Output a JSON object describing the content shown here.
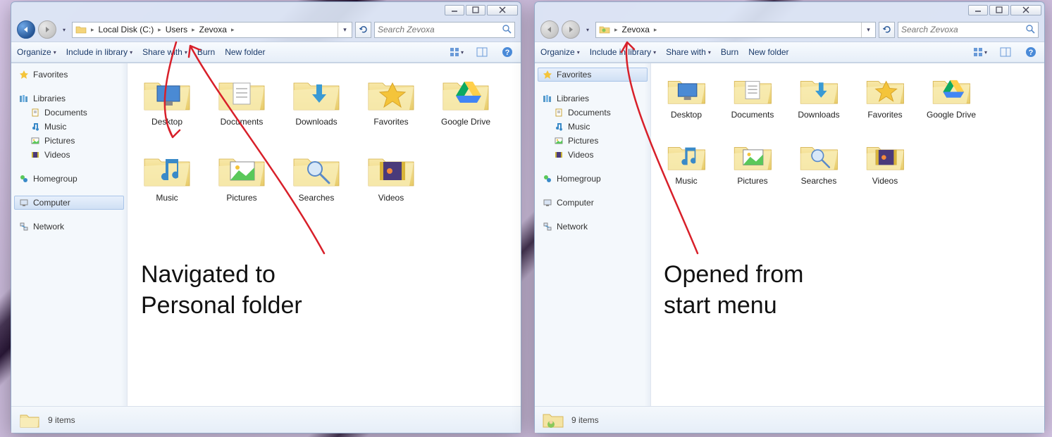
{
  "windows": {
    "left": {
      "breadcrumbs": [
        "Local Disk (C:)",
        "Users",
        "Zevoxa"
      ],
      "search_placeholder": "Search Zevoxa",
      "sidebar_selected": "Computer",
      "status_text": "9 items",
      "status_icon": "folder"
    },
    "right": {
      "breadcrumbs": [
        "Zevoxa"
      ],
      "search_placeholder": "Search Zevoxa",
      "sidebar_selected": "Favorites",
      "status_text": "9 items",
      "status_icon": "user-folder"
    }
  },
  "toolbar": {
    "organize": "Organize",
    "include": "Include in library",
    "share": "Share with",
    "burn": "Burn",
    "newfolder": "New folder"
  },
  "sidebar": {
    "favorites": "Favorites",
    "libraries": "Libraries",
    "documents": "Documents",
    "music": "Music",
    "pictures": "Pictures",
    "videos": "Videos",
    "homegroup": "Homegroup",
    "computer": "Computer",
    "network": "Network"
  },
  "folders": [
    {
      "name": "Desktop",
      "type": "desktop"
    },
    {
      "name": "Documents",
      "type": "documents"
    },
    {
      "name": "Downloads",
      "type": "downloads"
    },
    {
      "name": "Favorites",
      "type": "favorites"
    },
    {
      "name": "Google Drive",
      "type": "gdrive"
    },
    {
      "name": "Music",
      "type": "music"
    },
    {
      "name": "Pictures",
      "type": "pictures"
    },
    {
      "name": "Searches",
      "type": "searches"
    },
    {
      "name": "Videos",
      "type": "videos"
    }
  ],
  "annotations": {
    "left_line1": "Navigated to",
    "left_line2": "Personal folder",
    "right_line1": "Opened from",
    "right_line2": "start menu"
  }
}
